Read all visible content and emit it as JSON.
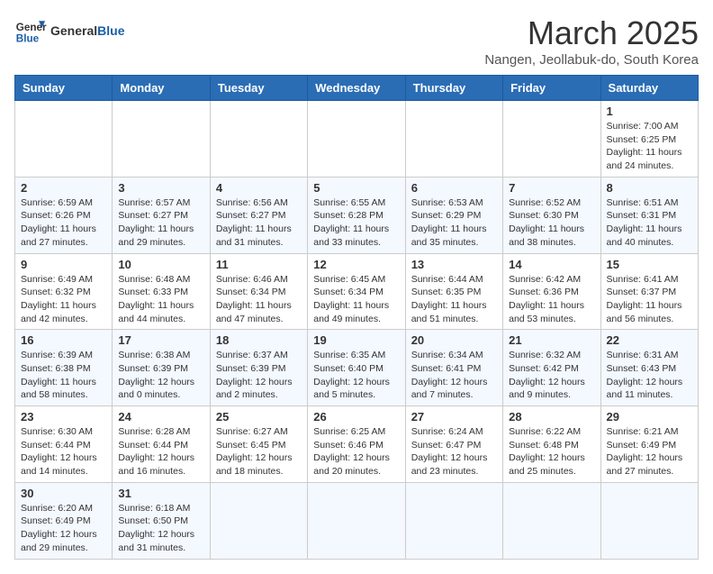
{
  "header": {
    "logo_general": "General",
    "logo_blue": "Blue",
    "month_title": "March 2025",
    "subtitle": "Nangen, Jeollabuk-do, South Korea"
  },
  "days_of_week": [
    "Sunday",
    "Monday",
    "Tuesday",
    "Wednesday",
    "Thursday",
    "Friday",
    "Saturday"
  ],
  "weeks": [
    [
      {
        "day": "",
        "info": ""
      },
      {
        "day": "",
        "info": ""
      },
      {
        "day": "",
        "info": ""
      },
      {
        "day": "",
        "info": ""
      },
      {
        "day": "",
        "info": ""
      },
      {
        "day": "",
        "info": ""
      },
      {
        "day": "1",
        "info": "Sunrise: 7:00 AM\nSunset: 6:25 PM\nDaylight: 11 hours and 24 minutes."
      }
    ],
    [
      {
        "day": "2",
        "info": "Sunrise: 6:59 AM\nSunset: 6:26 PM\nDaylight: 11 hours and 27 minutes."
      },
      {
        "day": "3",
        "info": "Sunrise: 6:57 AM\nSunset: 6:27 PM\nDaylight: 11 hours and 29 minutes."
      },
      {
        "day": "4",
        "info": "Sunrise: 6:56 AM\nSunset: 6:27 PM\nDaylight: 11 hours and 31 minutes."
      },
      {
        "day": "5",
        "info": "Sunrise: 6:55 AM\nSunset: 6:28 PM\nDaylight: 11 hours and 33 minutes."
      },
      {
        "day": "6",
        "info": "Sunrise: 6:53 AM\nSunset: 6:29 PM\nDaylight: 11 hours and 35 minutes."
      },
      {
        "day": "7",
        "info": "Sunrise: 6:52 AM\nSunset: 6:30 PM\nDaylight: 11 hours and 38 minutes."
      },
      {
        "day": "8",
        "info": "Sunrise: 6:51 AM\nSunset: 6:31 PM\nDaylight: 11 hours and 40 minutes."
      }
    ],
    [
      {
        "day": "9",
        "info": "Sunrise: 6:49 AM\nSunset: 6:32 PM\nDaylight: 11 hours and 42 minutes."
      },
      {
        "day": "10",
        "info": "Sunrise: 6:48 AM\nSunset: 6:33 PM\nDaylight: 11 hours and 44 minutes."
      },
      {
        "day": "11",
        "info": "Sunrise: 6:46 AM\nSunset: 6:34 PM\nDaylight: 11 hours and 47 minutes."
      },
      {
        "day": "12",
        "info": "Sunrise: 6:45 AM\nSunset: 6:34 PM\nDaylight: 11 hours and 49 minutes."
      },
      {
        "day": "13",
        "info": "Sunrise: 6:44 AM\nSunset: 6:35 PM\nDaylight: 11 hours and 51 minutes."
      },
      {
        "day": "14",
        "info": "Sunrise: 6:42 AM\nSunset: 6:36 PM\nDaylight: 11 hours and 53 minutes."
      },
      {
        "day": "15",
        "info": "Sunrise: 6:41 AM\nSunset: 6:37 PM\nDaylight: 11 hours and 56 minutes."
      }
    ],
    [
      {
        "day": "16",
        "info": "Sunrise: 6:39 AM\nSunset: 6:38 PM\nDaylight: 11 hours and 58 minutes."
      },
      {
        "day": "17",
        "info": "Sunrise: 6:38 AM\nSunset: 6:39 PM\nDaylight: 12 hours and 0 minutes."
      },
      {
        "day": "18",
        "info": "Sunrise: 6:37 AM\nSunset: 6:39 PM\nDaylight: 12 hours and 2 minutes."
      },
      {
        "day": "19",
        "info": "Sunrise: 6:35 AM\nSunset: 6:40 PM\nDaylight: 12 hours and 5 minutes."
      },
      {
        "day": "20",
        "info": "Sunrise: 6:34 AM\nSunset: 6:41 PM\nDaylight: 12 hours and 7 minutes."
      },
      {
        "day": "21",
        "info": "Sunrise: 6:32 AM\nSunset: 6:42 PM\nDaylight: 12 hours and 9 minutes."
      },
      {
        "day": "22",
        "info": "Sunrise: 6:31 AM\nSunset: 6:43 PM\nDaylight: 12 hours and 11 minutes."
      }
    ],
    [
      {
        "day": "23",
        "info": "Sunrise: 6:30 AM\nSunset: 6:44 PM\nDaylight: 12 hours and 14 minutes."
      },
      {
        "day": "24",
        "info": "Sunrise: 6:28 AM\nSunset: 6:44 PM\nDaylight: 12 hours and 16 minutes."
      },
      {
        "day": "25",
        "info": "Sunrise: 6:27 AM\nSunset: 6:45 PM\nDaylight: 12 hours and 18 minutes."
      },
      {
        "day": "26",
        "info": "Sunrise: 6:25 AM\nSunset: 6:46 PM\nDaylight: 12 hours and 20 minutes."
      },
      {
        "day": "27",
        "info": "Sunrise: 6:24 AM\nSunset: 6:47 PM\nDaylight: 12 hours and 23 minutes."
      },
      {
        "day": "28",
        "info": "Sunrise: 6:22 AM\nSunset: 6:48 PM\nDaylight: 12 hours and 25 minutes."
      },
      {
        "day": "29",
        "info": "Sunrise: 6:21 AM\nSunset: 6:49 PM\nDaylight: 12 hours and 27 minutes."
      }
    ],
    [
      {
        "day": "30",
        "info": "Sunrise: 6:20 AM\nSunset: 6:49 PM\nDaylight: 12 hours and 29 minutes."
      },
      {
        "day": "31",
        "info": "Sunrise: 6:18 AM\nSunset: 6:50 PM\nDaylight: 12 hours and 31 minutes."
      },
      {
        "day": "",
        "info": ""
      },
      {
        "day": "",
        "info": ""
      },
      {
        "day": "",
        "info": ""
      },
      {
        "day": "",
        "info": ""
      },
      {
        "day": "",
        "info": ""
      }
    ]
  ]
}
